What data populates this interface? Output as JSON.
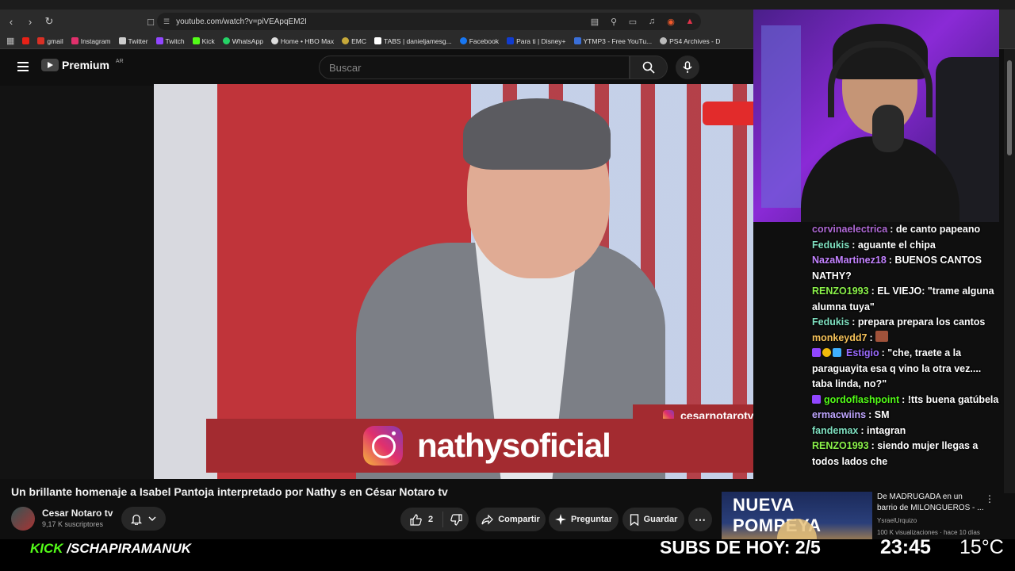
{
  "browser": {
    "url": "youtube.com/watch?v=piVEApqEM2I",
    "bookmarks": [
      {
        "label": "gmail",
        "color": "#d93025"
      },
      {
        "label": "Instagram",
        "color": "#e1306c"
      },
      {
        "label": "Twitter",
        "color": "#cccccc"
      },
      {
        "label": "Twitch",
        "color": "#9146ff"
      },
      {
        "label": "Kick",
        "color": "#53fc18"
      },
      {
        "label": "WhatsApp",
        "color": "#25d366"
      },
      {
        "label": "Home • HBO Max",
        "color": "#dddddd"
      },
      {
        "label": "EMC",
        "color": "#c7a93a"
      },
      {
        "label": "TABS | danieljamesg...",
        "color": "#ffffff"
      },
      {
        "label": "Facebook",
        "color": "#1877f2"
      },
      {
        "label": "Para ti | Disney+",
        "color": "#113ccf"
      },
      {
        "label": "YTMP3 - Free YouTu...",
        "color": "#3a6fd8"
      },
      {
        "label": "PS4 Archives - D",
        "color": "#bbbbbb"
      }
    ]
  },
  "youtube": {
    "logo": "Premium",
    "country": "AR",
    "search_placeholder": "Buscar",
    "video": {
      "instagram_small": "cesarnotarotv",
      "instagram_big": "nathysoficial"
    },
    "title": "Un brillante homenaje a Isabel Pantoja interpretado por Nathy s en César Notaro tv",
    "channel": "Cesar Notaro tv",
    "subscribers": "9,17 K suscriptores",
    "likes": "2",
    "share_label": "Compartir",
    "ask_label": "Preguntar",
    "save_label": "Guardar",
    "related": {
      "thumb_text": "NUEVA POMPEYA",
      "title": "De MADRUGADA en un barrio de MILONGUEROS - ...",
      "channel": "YsraelUrquizo",
      "meta": "100 K visualizaciones · hace 10 días"
    }
  },
  "chat": [
    {
      "user": "corvinaelectrica",
      "color": "#b06ad6",
      "text": ": de canto papeano",
      "badges": []
    },
    {
      "user": "Fedukis",
      "color": "#7fe0c0",
      "text": ": aguante el chipa",
      "badges": []
    },
    {
      "user": "NazaMartinez18",
      "color": "#c383ff",
      "text": ": BUENOS CANTOS NATHY?",
      "badges": []
    },
    {
      "user": "RENZO1993",
      "color": "#8bf24a",
      "text": ": EL VIEJO: \"trame alguna alumna tuya\"",
      "badges": []
    },
    {
      "user": "Fedukis",
      "color": "#7fe0c0",
      "text": ": prepara prepara los cantos",
      "badges": []
    },
    {
      "user": "monkeydd7",
      "color": "#f7c35a",
      "text": ":",
      "badges": [],
      "emote": true
    },
    {
      "user": "Estigio",
      "color": "#9b6bff",
      "text": ": \"che, traete a la paraguayita esa q vino la otra vez.... taba linda, no?\"",
      "badges": [
        "#9146ff",
        "#f0b90b",
        "#3fb0ff"
      ]
    },
    {
      "user": "gordoflashpoint",
      "color": "#53fc18",
      "text": ": !tts buena gatúbela",
      "badges": [
        "#9146ff"
      ]
    },
    {
      "user": "ermacwiins",
      "color": "#bfa6ff",
      "text": ": SM",
      "badges": []
    },
    {
      "user": "fandemax",
      "color": "#7fe0c0",
      "text": ": intagran",
      "badges": []
    },
    {
      "user": "RENZO1993",
      "color": "#8bf24a",
      "text": ": siendo mujer llegas a todos lados che",
      "badges": []
    }
  ],
  "overlay": {
    "kick_label": "KICK",
    "kick_channel": "/SCHAPIRAMANUK",
    "subs_goal": "SUBS DE HOY: 2/5",
    "clock": "23:45",
    "temperature": "15°C"
  }
}
